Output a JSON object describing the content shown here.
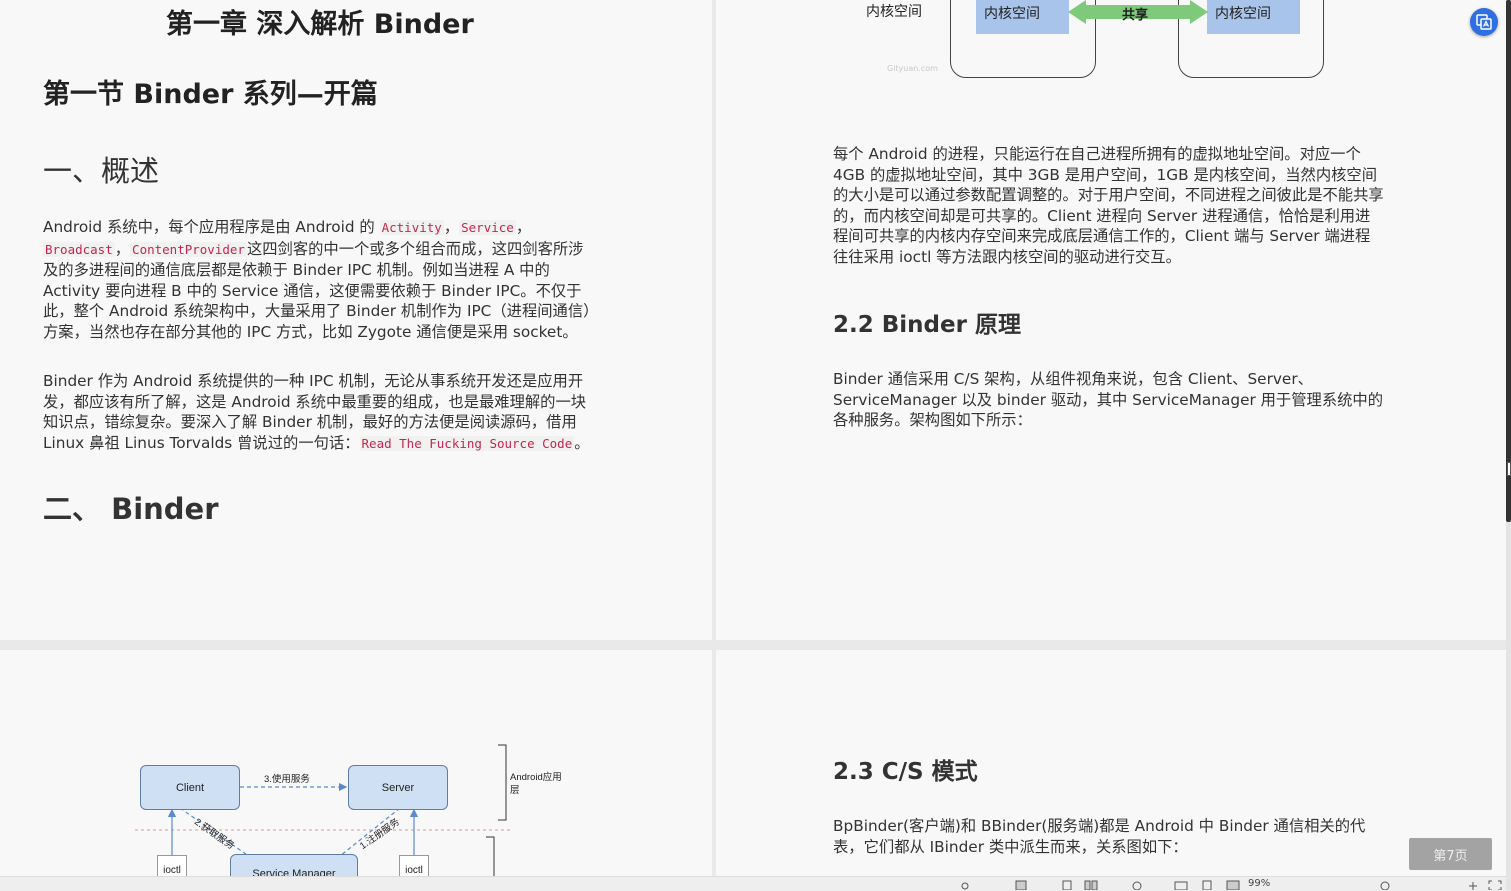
{
  "left_top": {
    "chapter_title": "第一章 深入解析 Binder",
    "section_title": "第一节 Binder 系列—开篇",
    "h_overview": "一、概述",
    "p1_a": "Android 系统中，每个应用程序是由 Android 的 ",
    "p1_code1": "Activity",
    "p1_sep1": "，",
    "p1_code2": "Service",
    "p1_sep2": "，",
    "p1_code3": "Broadcast",
    "p1_sep3": "，",
    "p1_code4": "ContentProvider",
    "p1_b": "这四剑客的中一个或多个组合而成，这四剑客所涉及的多进程间的通信底层都是依赖于 Binder IPC 机制。例如当进程 A 中的 Activity 要向进程 B 中的 Service 通信，这便需要依赖于 Binder IPC。不仅于此，整个 Android 系统架构中，大量采用了 Binder 机制作为 IPC（进程间通信）方案，当然也存在部分其他的 IPC 方式，比如 Zygote 通信便是采用 socket。",
    "p2_a": "Binder 作为 Android 系统提供的一种 IPC 机制，无论从事系统开发还是应用开发，都应该有所了解，这是 Android 系统中最重要的组成，也是最难理解的一块知识点，错综复杂。要深入了解 Binder 机制，最好的方法便是阅读源码，借用 Linux 鼻祖 Linus Torvalds 曾说过的一句话：",
    "p2_code": "Read The Fucking Source Code",
    "p2_end": "。",
    "h_binder": "二、  Binder"
  },
  "right_top": {
    "diagram": {
      "kernel_label": "内核空间",
      "box_left": "内核空间",
      "share": "共享",
      "box_right": "内核空间",
      "watermark": "Gityuan.com"
    },
    "p1": "每个 Android 的进程，只能运行在自己进程所拥有的虚拟地址空间。对应一个 4GB 的虚拟地址空间，其中 3GB 是用户空间，1GB 是内核空间，当然内核空间的大小是可以通过参数配置调整的。对于用户空间，不同进程之间彼此是不能共享的，而内核空间却是可共享的。Client 进程向 Server 进程通信，恰恰是利用进程间可共享的内核内存空间来完成底层通信工作的，Client 端与 Server 端进程往往采用 ioctl 等方法跟内核空间的驱动进行交互。",
    "h22": "2.2 Binder 原理",
    "p2": "Binder 通信采用 C/S 架构，从组件视角来说，包含 Client、Server、ServiceManager 以及 binder 驱动，其中 ServiceManager 用于管理系统中的各种服务。架构图如下所示："
  },
  "left_bottom": {
    "diagram": {
      "client": "Client",
      "server": "Server",
      "use_service": "3.使用服务",
      "get_service": "2.获取服务",
      "register_service": "1.注册服务",
      "service_manager": "Service Manager",
      "ioctl": "ioctl",
      "app_layer": "Android应用层"
    }
  },
  "right_bottom": {
    "h23": "2.3 C/S 模式",
    "p1": "BpBinder(客户端)和 BBinder(服务端)都是 Android 中 Binder 通信相关的代表，它们都从 IBinder 类中派生而来，关系图如下："
  },
  "controls": {
    "page_indicator": "第7页",
    "zoom": "99%",
    "float_icon": "translate-icon"
  },
  "colors": {
    "code": "#c7254e",
    "kernel_box": "#a9c4ea",
    "share_arrow": "#7fc97b",
    "node_fill": "#cfe0f5",
    "accent": "#2f6fe0"
  }
}
